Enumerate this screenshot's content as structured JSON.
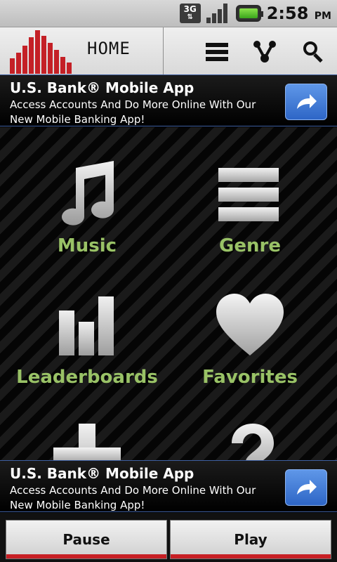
{
  "status_bar": {
    "network": "3G",
    "time": "2:58",
    "ampm": "PM"
  },
  "header": {
    "title": "HOME"
  },
  "ads": [
    {
      "title": "U.S. Bank® Mobile App",
      "line1": "Access Accounts And Do More Online With Our",
      "line2": "New Mobile Banking App!"
    },
    {
      "title": "U.S. Bank® Mobile App",
      "line1": "Access Accounts And Do More Online With Our",
      "line2": "New Mobile Banking App!"
    }
  ],
  "tiles": [
    {
      "label": "Music",
      "icon": "music-note-icon"
    },
    {
      "label": "Genre",
      "icon": "list-bars-icon"
    },
    {
      "label": "Leaderboards",
      "icon": "bar-chart-icon"
    },
    {
      "label": "Favorites",
      "icon": "heart-icon"
    }
  ],
  "controls": {
    "pause": "Pause",
    "play": "Play"
  },
  "colors": {
    "brand_red": "#c42026",
    "tile_label_green": "#99c266",
    "ad_button_blue": "#2e66c6"
  }
}
